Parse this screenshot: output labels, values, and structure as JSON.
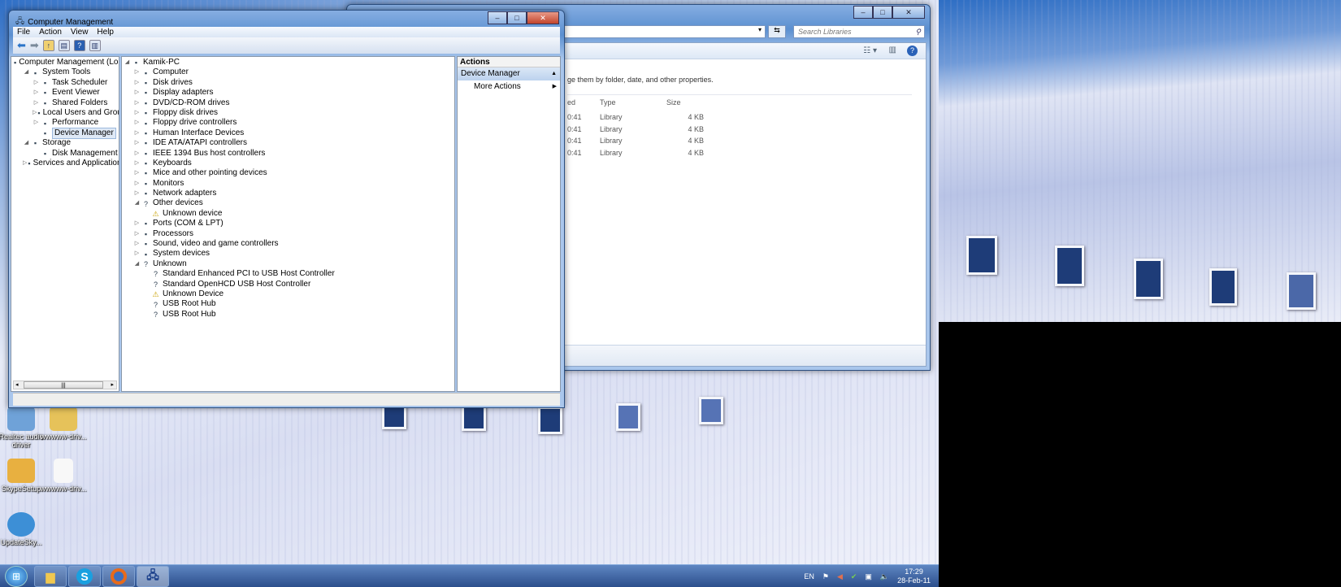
{
  "colors": {
    "title_bar": "#5b8fd0",
    "taskbar": "#2c4f8c",
    "close_button": "#c2442c"
  },
  "cm": {
    "title": "Computer Management",
    "menu": [
      "File",
      "Action",
      "View",
      "Help"
    ],
    "toolbar_icons": [
      "back-arrow-icon",
      "forward-arrow-icon",
      "up-folder-icon",
      "show-hide-tree-icon",
      "help-icon",
      "show-hide-action-pane-icon"
    ],
    "left_tree": [
      {
        "label": "Computer Management (Local",
        "level": 0,
        "exp": "",
        "icon": "computer-management-icon"
      },
      {
        "label": "System Tools",
        "level": 1,
        "exp": "open",
        "icon": "tools-icon"
      },
      {
        "label": "Task Scheduler",
        "level": 2,
        "exp": "closed",
        "icon": "clock-icon"
      },
      {
        "label": "Event Viewer",
        "level": 2,
        "exp": "closed",
        "icon": "event-viewer-icon"
      },
      {
        "label": "Shared Folders",
        "level": 2,
        "exp": "closed",
        "icon": "shared-folder-icon"
      },
      {
        "label": "Local Users and Groups",
        "level": 2,
        "exp": "closed",
        "icon": "users-icon"
      },
      {
        "label": "Performance",
        "level": 2,
        "exp": "closed",
        "icon": "performance-icon"
      },
      {
        "label": "Device Manager",
        "level": 2,
        "exp": "",
        "icon": "device-manager-icon",
        "selected": true
      },
      {
        "label": "Storage",
        "level": 1,
        "exp": "open",
        "icon": "storage-icon"
      },
      {
        "label": "Disk Management",
        "level": 2,
        "exp": "",
        "icon": "disk-icon"
      },
      {
        "label": "Services and Applications",
        "level": 1,
        "exp": "closed",
        "icon": "services-icon"
      }
    ],
    "device_tree": [
      {
        "label": "Kamik-PC",
        "level": 0,
        "exp": "open",
        "icon": "computer-icon"
      },
      {
        "label": "Computer",
        "level": 1,
        "exp": "closed",
        "icon": "computer-icon"
      },
      {
        "label": "Disk drives",
        "level": 1,
        "exp": "closed",
        "icon": "disk-drive-icon"
      },
      {
        "label": "Display adapters",
        "level": 1,
        "exp": "closed",
        "icon": "display-adapter-icon"
      },
      {
        "label": "DVD/CD-ROM drives",
        "level": 1,
        "exp": "closed",
        "icon": "dvd-icon"
      },
      {
        "label": "Floppy disk drives",
        "level": 1,
        "exp": "closed",
        "icon": "floppy-icon"
      },
      {
        "label": "Floppy drive controllers",
        "level": 1,
        "exp": "closed",
        "icon": "floppy-controller-icon"
      },
      {
        "label": "Human Interface Devices",
        "level": 1,
        "exp": "closed",
        "icon": "hid-icon"
      },
      {
        "label": "IDE ATA/ATAPI controllers",
        "level": 1,
        "exp": "closed",
        "icon": "ide-icon"
      },
      {
        "label": "IEEE 1394 Bus host controllers",
        "level": 1,
        "exp": "closed",
        "icon": "ieee1394-icon"
      },
      {
        "label": "Keyboards",
        "level": 1,
        "exp": "closed",
        "icon": "keyboard-icon"
      },
      {
        "label": "Mice and other pointing devices",
        "level": 1,
        "exp": "closed",
        "icon": "mouse-icon"
      },
      {
        "label": "Monitors",
        "level": 1,
        "exp": "closed",
        "icon": "monitor-icon"
      },
      {
        "label": "Network adapters",
        "level": 1,
        "exp": "closed",
        "icon": "network-icon"
      },
      {
        "label": "Other devices",
        "level": 1,
        "exp": "open",
        "icon": "unknown-device-icon"
      },
      {
        "label": "Unknown device",
        "level": 2,
        "exp": "",
        "icon": "warning-device-icon"
      },
      {
        "label": "Ports (COM & LPT)",
        "level": 1,
        "exp": "closed",
        "icon": "port-icon"
      },
      {
        "label": "Processors",
        "level": 1,
        "exp": "closed",
        "icon": "processor-icon"
      },
      {
        "label": "Sound, video and game controllers",
        "level": 1,
        "exp": "closed",
        "icon": "sound-icon"
      },
      {
        "label": "System devices",
        "level": 1,
        "exp": "closed",
        "icon": "system-device-icon"
      },
      {
        "label": "Unknown",
        "level": 1,
        "exp": "open",
        "icon": "unknown-icon"
      },
      {
        "label": "Standard Enhanced PCI to USB Host Controller",
        "level": 2,
        "exp": "",
        "icon": "unknown-device-icon"
      },
      {
        "label": "Standard OpenHCD USB Host Controller",
        "level": 2,
        "exp": "",
        "icon": "unknown-device-icon"
      },
      {
        "label": "Unknown Device",
        "level": 2,
        "exp": "",
        "icon": "warning-device-icon"
      },
      {
        "label": "USB Root Hub",
        "level": 2,
        "exp": "",
        "icon": "unknown-device-icon"
      },
      {
        "label": "USB Root Hub",
        "level": 2,
        "exp": "",
        "icon": "unknown-device-icon"
      }
    ],
    "actions": {
      "header": "Actions",
      "section": "Device Manager",
      "item": "More Actions"
    }
  },
  "explorer": {
    "search_placeholder": "Search Libraries",
    "description": "ge them by folder, date, and other properties.",
    "columns": [
      "ed",
      "Type",
      "Size"
    ],
    "rows": [
      {
        "date": "0:41",
        "type": "Library",
        "size": "4 KB"
      },
      {
        "date": "0:41",
        "type": "Library",
        "size": "4 KB"
      },
      {
        "date": "0:41",
        "type": "Library",
        "size": "4 KB"
      },
      {
        "date": "0:41",
        "type": "Library",
        "size": "4 KB"
      }
    ]
  },
  "desktop_icons": [
    {
      "label": "Realtec audio driver",
      "icon": "installer-icon"
    },
    {
      "label": "wwwww-driv...",
      "icon": "zip-folder-icon"
    },
    {
      "label": "SkypeSetup",
      "icon": "installer-icon"
    },
    {
      "label": "wwwww-driv...",
      "icon": "file-icon"
    },
    {
      "label": "UpdateSky...",
      "icon": "update-icon"
    }
  ],
  "taskbar": {
    "buttons": [
      {
        "name": "start-button",
        "icon": "windows-logo-icon"
      },
      {
        "name": "explorer-taskbar-button",
        "icon": "folder-icon"
      },
      {
        "name": "skype-taskbar-button",
        "icon": "skype-icon"
      },
      {
        "name": "firefox-taskbar-button",
        "icon": "firefox-icon"
      },
      {
        "name": "computer-management-taskbar-button",
        "icon": "computer-management-icon"
      }
    ],
    "language": "EN",
    "time": "17:29",
    "date": "28-Feb-11"
  }
}
